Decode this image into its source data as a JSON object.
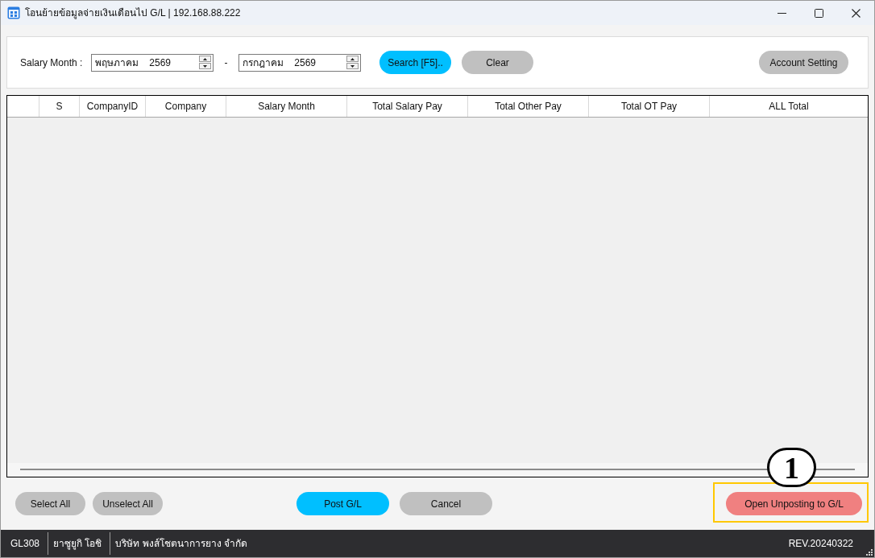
{
  "window": {
    "title": "โอนย้ายข้อมูลจ่ายเงินเดือนไป G/L | 192.168.88.222"
  },
  "filter": {
    "label": "Salary Month :",
    "from": {
      "value": "พฤษภาคม    2569"
    },
    "separator": "-",
    "to": {
      "value": "กรกฎาคม    2569"
    },
    "buttons": [
      {
        "label": "Search [F5]..",
        "kind": "primary"
      },
      {
        "label": "Clear",
        "kind": "secondary"
      }
    ],
    "settings_button": {
      "label": "Account Setting",
      "kind": "secondary"
    }
  },
  "table": {
    "columns": [
      {
        "label": "S"
      },
      {
        "label": "CompanyID"
      },
      {
        "label": "Company"
      },
      {
        "label": "Salary Month"
      },
      {
        "label": "Total Salary Pay"
      },
      {
        "label": "Total Other Pay"
      },
      {
        "label": "Total OT Pay"
      },
      {
        "label": "ALL Total"
      }
    ]
  },
  "actions": {
    "left": [
      {
        "label": "Select All",
        "kind": "secondary"
      },
      {
        "label": "Unselect All",
        "kind": "secondary"
      }
    ],
    "center": [
      {
        "label": "Post G/L",
        "kind": "primary"
      },
      {
        "label": "Cancel",
        "kind": "secondary"
      }
    ],
    "right": [
      {
        "label": "Open Unposting to G/L",
        "kind": "danger",
        "highlighted": true,
        "callout": "1"
      }
    ]
  },
  "status_bar": {
    "items": [
      "GL308",
      "ยาซูยูกิ โอชิ",
      "บริษัท พงส์โชตนาการยาง จำกัด"
    ],
    "version": "REV.20240322"
  }
}
